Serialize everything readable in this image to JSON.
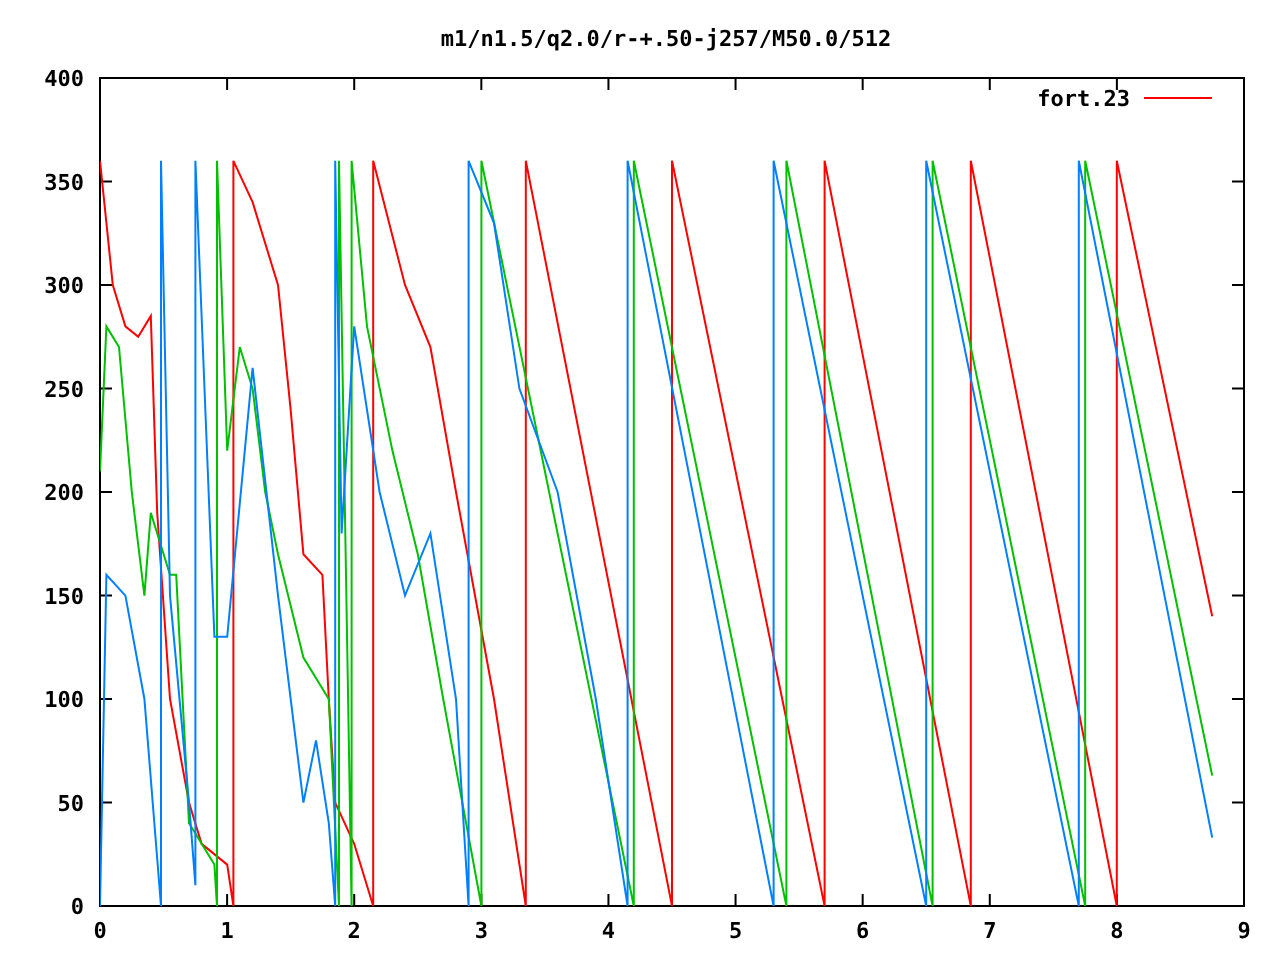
{
  "chart_data": {
    "type": "line",
    "title": "m1/n1.5/q2.0/r-+.50-j257/M50.0/512",
    "xlim": [
      0,
      9
    ],
    "ylim": [
      0,
      400
    ],
    "xticks": [
      0,
      1,
      2,
      3,
      4,
      5,
      6,
      7,
      8,
      9
    ],
    "yticks": [
      0,
      50,
      100,
      150,
      200,
      250,
      300,
      350,
      400
    ],
    "series": [
      {
        "name": "fort.23",
        "color": "#ff0000",
        "x": [
          0,
          0.1,
          0.2,
          0.3,
          0.4,
          0.45,
          0.55,
          0.7,
          0.8,
          1.0,
          1.05,
          1.05,
          1.2,
          1.4,
          1.5,
          1.6,
          1.75,
          1.8,
          1.85,
          2.0,
          2.15,
          2.15,
          2.4,
          2.6,
          2.8,
          3.1,
          3.35,
          3.35,
          4.5,
          4.5,
          5.7,
          5.7,
          6.85,
          6.85,
          8.0,
          8.0,
          8.75
        ],
        "values": [
          360,
          300,
          280,
          275,
          285,
          190,
          100,
          50,
          30,
          20,
          0,
          360,
          340,
          300,
          240,
          170,
          160,
          100,
          50,
          30,
          0,
          360,
          300,
          270,
          200,
          100,
          0,
          360,
          0,
          360,
          0,
          360,
          0,
          360,
          0,
          360,
          140
        ]
      },
      {
        "color": "#00c000",
        "x": [
          0,
          0.05,
          0.15,
          0.25,
          0.35,
          0.4,
          0.55,
          0.6,
          0.7,
          0.75,
          0.9,
          0.92,
          0.92,
          1.0,
          1.1,
          1.2,
          1.3,
          1.4,
          1.6,
          1.8,
          1.88,
          1.88,
          1.98,
          1.98,
          2.1,
          2.3,
          2.5,
          2.7,
          3.0,
          3.0,
          4.2,
          4.2,
          5.4,
          5.4,
          6.55,
          6.55,
          7.75,
          7.75,
          8.75
        ],
        "values": [
          210,
          280,
          270,
          200,
          150,
          190,
          160,
          160,
          40,
          35,
          20,
          0,
          360,
          220,
          270,
          250,
          200,
          170,
          120,
          100,
          0,
          360,
          0,
          360,
          280,
          220,
          170,
          100,
          0,
          360,
          0,
          360,
          0,
          360,
          0,
          360,
          0,
          360,
          63
        ]
      },
      {
        "color": "#0080ff",
        "x": [
          0,
          0.05,
          0.2,
          0.35,
          0.48,
          0.48,
          0.55,
          0.7,
          0.75,
          0.75,
          0.9,
          1.0,
          1.2,
          1.4,
          1.6,
          1.7,
          1.8,
          1.85,
          1.85,
          1.9,
          2.0,
          2.2,
          2.4,
          2.6,
          2.8,
          2.9,
          2.9,
          3.1,
          3.3,
          3.6,
          3.9,
          4.15,
          4.15,
          5.3,
          5.3,
          6.5,
          6.5,
          7.7,
          7.7,
          8.75
        ],
        "values": [
          0,
          160,
          150,
          100,
          0,
          360,
          150,
          50,
          10,
          360,
          130,
          130,
          260,
          150,
          50,
          80,
          40,
          0,
          360,
          180,
          280,
          200,
          150,
          180,
          100,
          0,
          360,
          330,
          250,
          200,
          100,
          0,
          360,
          0,
          360,
          0,
          360,
          0,
          360,
          33
        ]
      }
    ]
  }
}
